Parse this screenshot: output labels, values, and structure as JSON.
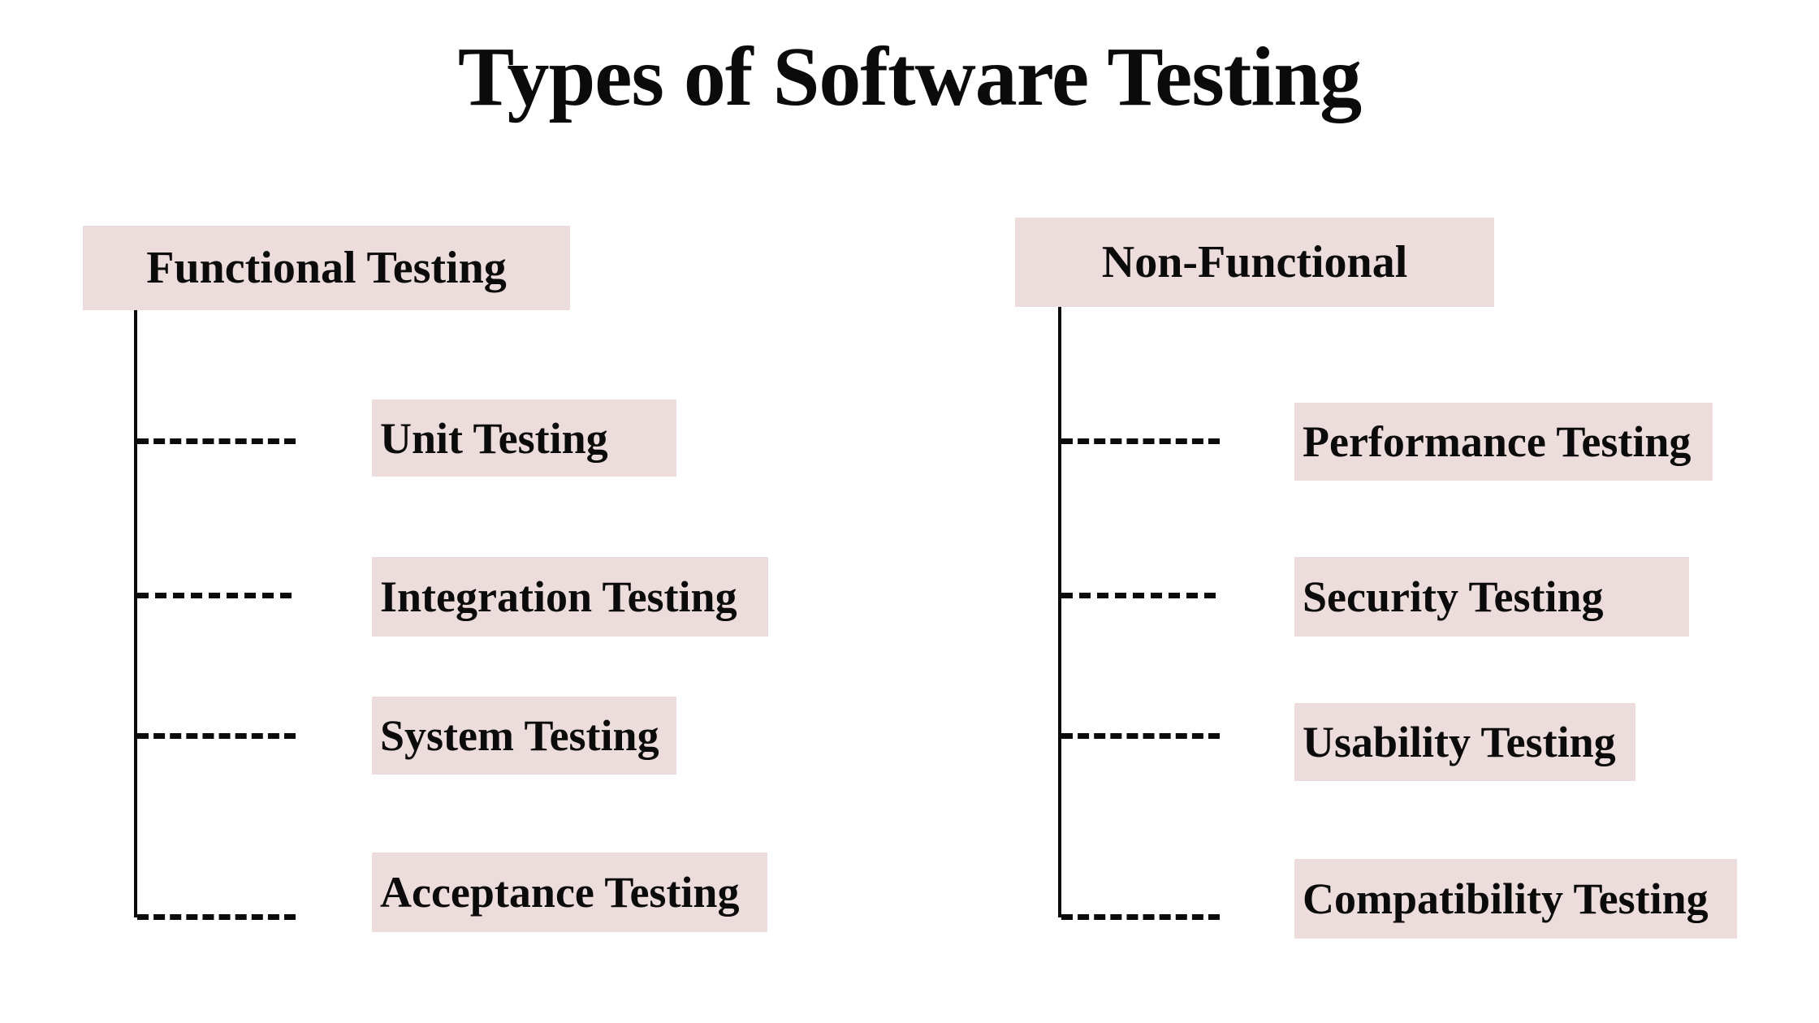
{
  "title": "Types of Software Testing",
  "colors": {
    "box_fill": "#EDDCDC",
    "text": "#0B0B0B",
    "line": "#0B0B0B",
    "background": "#FFFFFF"
  },
  "branches": [
    {
      "id": "functional",
      "header": "Functional Testing",
      "items": [
        {
          "label": "Unit Testing"
        },
        {
          "label": "Integration Testing"
        },
        {
          "label": "System Testing"
        },
        {
          "label": "Acceptance Testing"
        }
      ]
    },
    {
      "id": "non-functional",
      "header": "Non-Functional",
      "items": [
        {
          "label": "Performance Testing"
        },
        {
          "label": "Security Testing"
        },
        {
          "label": "Usability Testing"
        },
        {
          "label": "Compatibility Testing"
        }
      ]
    }
  ]
}
